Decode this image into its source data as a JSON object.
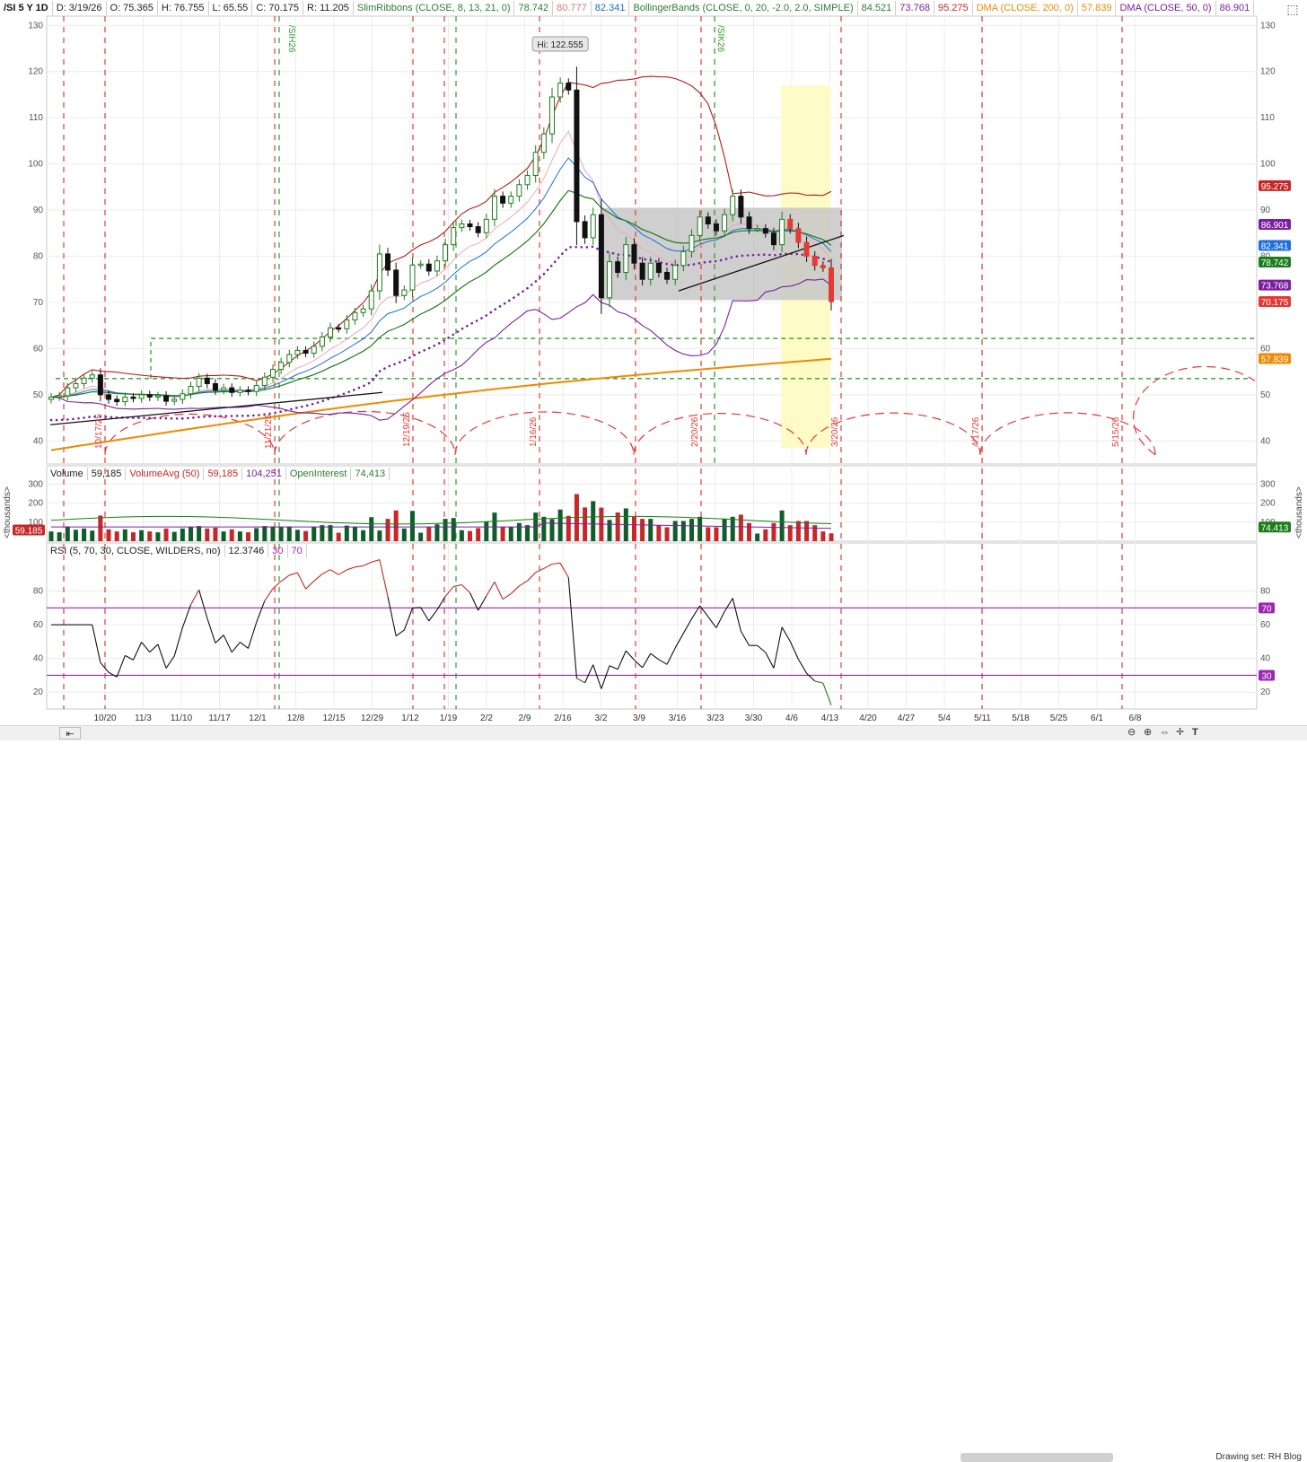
{
  "header": {
    "symbol": "/SI 5 Y 1D",
    "date": "D: 3/19/26",
    "open": "O: 75.365",
    "high": "H: 76.755",
    "low": "L: 65.55",
    "close": "C: 70.175",
    "range": "R: 11.205",
    "slim_label": "SlimRibbons (CLOSE, 8, 13, 21, 0)",
    "slim_v1": "78.742",
    "slim_v2": "80.777",
    "slim_v3": "82.341",
    "bb_label": "BollingerBands (CLOSE, 0, 20, -2.0, 2.0, SIMPLE)",
    "bb_v1": "84.521",
    "bb_v2": "73.768",
    "bb_v3": "95.275",
    "dma200_label": "DMA (CLOSE, 200, 0)",
    "dma200_v": "57.839",
    "dma50_label": "DMA (CLOSE, 50, 0)",
    "dma50_v": "86.901"
  },
  "volume_header": {
    "vol_label": "Volume",
    "vol_v": "59,185",
    "vavg_label": "VolumeAvg (50)",
    "vavg_v1": "59,185",
    "vavg_v2": "104,251",
    "oi_label": "OpenInterest",
    "oi_v": "74,413"
  },
  "rsi_header": {
    "label": "RSI (5, 70, 30, CLOSE, WILDERS, no)",
    "v": "12.3746",
    "lo": "30",
    "hi": "70"
  },
  "units_label": "<thousands>",
  "footer": {
    "drawing_set": "Drawing set: RH Blog"
  },
  "price_tags": [
    {
      "text": "95.275",
      "value": 95.275,
      "color": "#c62828"
    },
    {
      "text": "86.901",
      "value": 86.901,
      "color": "#7b1fa2"
    },
    {
      "text": "82.341",
      "value": 82.341,
      "color": "#1e6fd9"
    },
    {
      "text": "78.742",
      "value": 78.742,
      "color": "#1b7d1b"
    },
    {
      "text": "73.768",
      "value": 73.768,
      "color": "#7b1fa2"
    },
    {
      "text": "70.175",
      "value": 70.175,
      "color": "#e53935"
    },
    {
      "text": "57.839",
      "value": 57.839,
      "color": "#ef8a00"
    }
  ],
  "volume_tags": [
    {
      "text": "59.185",
      "side": "left",
      "color": "#c62828"
    },
    {
      "text": "74.413",
      "side": "right",
      "color": "#1b7d1b"
    }
  ],
  "rsi_tags": [
    {
      "text": "70",
      "value": 70,
      "color": "#9c27b0"
    },
    {
      "text": "30",
      "value": 30,
      "color": "#9c27b0"
    }
  ],
  "chart_data": {
    "type": "candlestick",
    "title": "/SI 5 Y 1D",
    "price_axis": {
      "ylim": [
        35,
        132
      ],
      "ticks": [
        40,
        50,
        60,
        70,
        80,
        90,
        100,
        110,
        120,
        130
      ]
    },
    "date_ticks": [
      "10/20",
      "11/3",
      "11/10",
      "11/17",
      "12/1",
      "12/8",
      "12/15",
      "12/29",
      "1/12",
      "1/19",
      "2/2",
      "2/9",
      "2/16",
      "3/2",
      "3/9",
      "3/16",
      "3/23",
      "3/30",
      "4/6",
      "4/13",
      "4/20",
      "4/27",
      "5/4",
      "5/11",
      "5/18",
      "5/25",
      "6/1",
      "6/8"
    ],
    "cycle_date_labels": [
      "10/17/25",
      "11/21/25",
      "12/19/25",
      "1/16/26",
      "2/20/26",
      "3/20/26",
      "4/17/26",
      "5/15/26"
    ],
    "contract_roll_labels": [
      "/SIH26",
      "/SIK26"
    ],
    "annotation": "Hi: 122.555",
    "closes": [
      49.5,
      49.8,
      51.5,
      52.4,
      53.6,
      54.3,
      50.0,
      49.0,
      48.5,
      49.5,
      49.2,
      50.0,
      49.5,
      49.8,
      48.6,
      49.0,
      50.2,
      51.8,
      53.6,
      52.4,
      51.0,
      51.5,
      50.5,
      51.0,
      50.7,
      52.0,
      53.8,
      55.5,
      57.0,
      58.7,
      59.6,
      59.0,
      60.5,
      62.5,
      64.5,
      64.3,
      66.2,
      67.8,
      68.6,
      72.5,
      80.5,
      77.0,
      71.5,
      72.7,
      78.1,
      78.3,
      76.8,
      79.0,
      82.5,
      86.2,
      87.0,
      86.4,
      85.1,
      88.0,
      93.0,
      91.5,
      93.0,
      95.5,
      97.5,
      102.5,
      106.5,
      114.5,
      117.5,
      116.0,
      87.5,
      84.0,
      89.0,
      71.0,
      78.8,
      76.5,
      82.5,
      78.5,
      75.0,
      78.5,
      76.5,
      75.0,
      78.0,
      81.0,
      84.5,
      88.5,
      87.0,
      85.5,
      89.0,
      93.0,
      88.5,
      86.0,
      86.0,
      85.0,
      82.5,
      88.0,
      86.0,
      83.0,
      80.0,
      78.0,
      77.5,
      70.175
    ],
    "rsi": {
      "ylim": [
        10,
        100
      ],
      "ticks": [
        20,
        40,
        60,
        80
      ],
      "overbought": 70,
      "oversold": 30,
      "last": 12.3746
    },
    "volume": {
      "ylim": [
        0,
        320
      ],
      "ticks": [
        100,
        200,
        300
      ],
      "units": "thousands",
      "last": 59.185,
      "avg_50": 104.251,
      "open_interest": 74.413
    },
    "moving_averages": [
      {
        "name": "DMA (CLOSE, 200, 0)",
        "last": 57.839,
        "color": "#ef8a00"
      },
      {
        "name": "DMA (CLOSE, 50, 0)",
        "last": 86.901,
        "color": "#7b1fa2"
      }
    ],
    "bollinger": {
      "upper": 95.275,
      "middle": 84.521,
      "lower": 73.768
    }
  }
}
